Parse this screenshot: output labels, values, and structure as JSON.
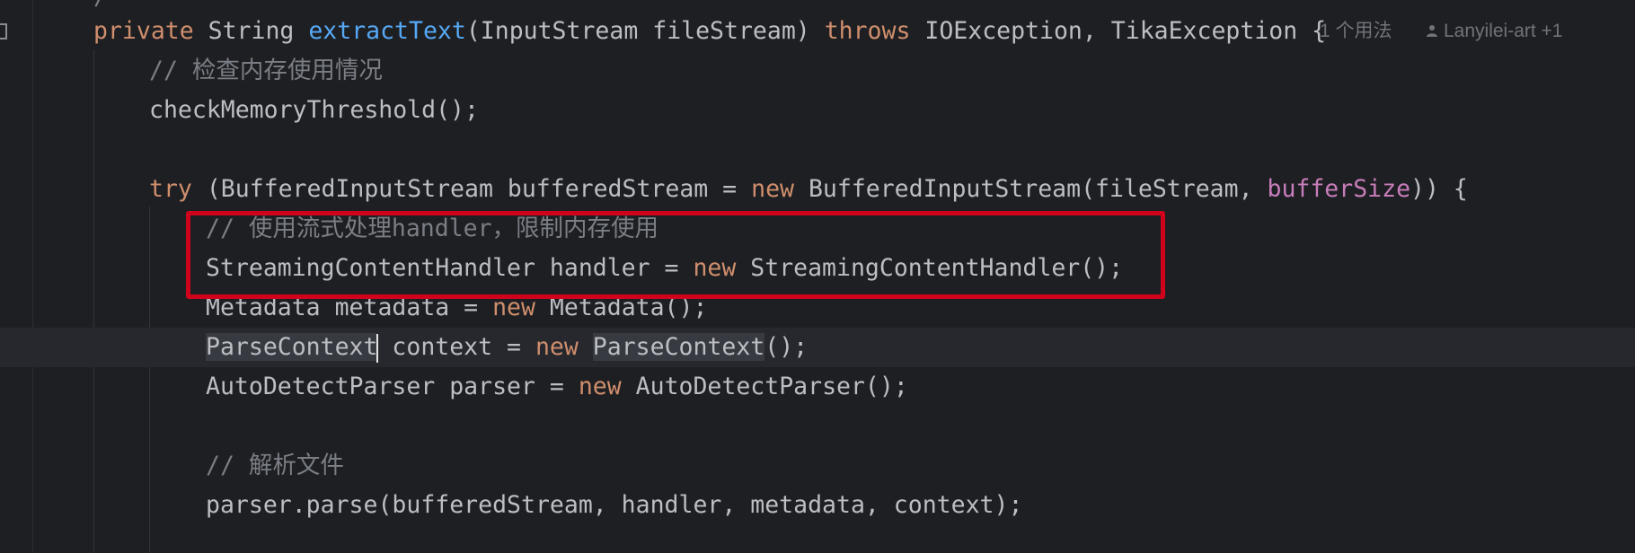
{
  "editor": {
    "partial_top_fragment": "/",
    "line1": {
      "kw_private": "private",
      "type_string": " String ",
      "method_name": "extractText",
      "params": "(InputStream fileStream) ",
      "kw_throws": "throws",
      "exceptions": " IOException, TikaException {",
      "usages_hint": "1 个用法",
      "author_hint": "Lanyilei-art +1"
    },
    "line2": {
      "comment": "// 检查内存使用情况"
    },
    "line3": {
      "text": "checkMemoryThreshold();"
    },
    "line5": {
      "kw_try": "try",
      "part1": " (BufferedInputStream bufferedStream = ",
      "kw_new": "new",
      "part2": " BufferedInputStream(fileStream, ",
      "field": "bufferSize",
      "part3": ")) {"
    },
    "line6": {
      "comment": "// 使用流式处理handler，限制内存使用"
    },
    "line7": {
      "part1": "StreamingContentHandler handler = ",
      "kw_new": "new",
      "part2": " StreamingContentHandler();"
    },
    "line8": {
      "part1": "Metadata metadata = ",
      "kw_new": "new",
      "part2": " Metadata();"
    },
    "line9": {
      "type_hl": "ParseContext",
      "part1": " context = ",
      "kw_new": "new",
      "ctor_hl": "ParseContext",
      "part2": "();"
    },
    "line10": {
      "part1": "AutoDetectParser parser = ",
      "kw_new": "new",
      "part2": " AutoDetectParser();"
    },
    "line12": {
      "comment": "// 解析文件"
    },
    "line13": {
      "text": "parser.parse(bufferedStream, handler, metadata, context);"
    }
  },
  "colors": {
    "background": "#1e1f22",
    "keyword": "#cf8e6d",
    "method": "#56a8f5",
    "field": "#c77dbb",
    "comment": "#7a7e85",
    "text": "#bcbec4",
    "annotation_box": "#d0021b"
  }
}
